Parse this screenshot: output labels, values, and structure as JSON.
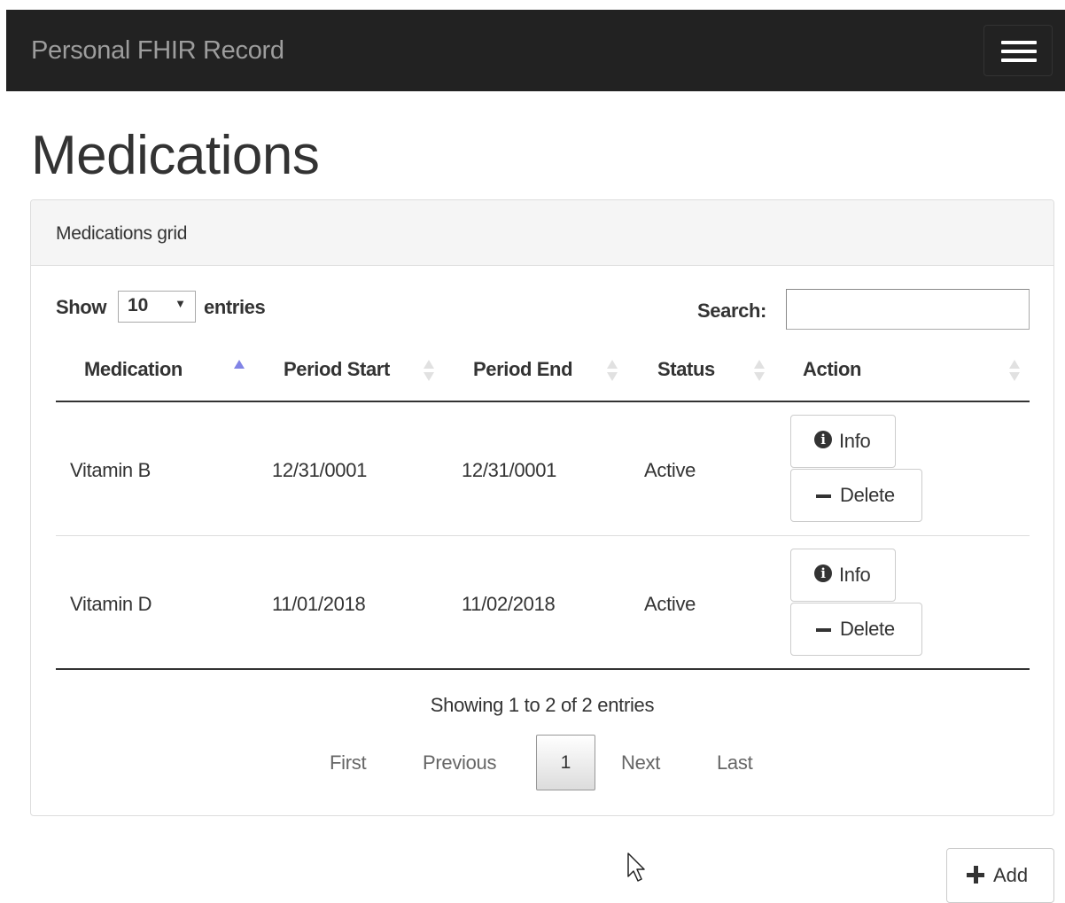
{
  "navbar": {
    "brand": "Personal FHIR Record",
    "menu_icon": "hamburger-menu-icon"
  },
  "page": {
    "title": "Medications"
  },
  "panel": {
    "heading": "Medications grid"
  },
  "length_control": {
    "show_label": "Show",
    "selected": "10",
    "entries_label": "entries"
  },
  "search": {
    "label": "Search:",
    "value": ""
  },
  "table": {
    "columns": [
      "Medication",
      "Period Start",
      "Period End",
      "Status",
      "Action"
    ],
    "sorted_column": "Medication",
    "sort_direction": "ascending",
    "rows": [
      {
        "medication": "Vitamin B",
        "period_start": "12/31/0001",
        "period_end": "12/31/0001",
        "status": "Active",
        "info_label": "Info",
        "delete_label": "Delete"
      },
      {
        "medication": "Vitamin D",
        "period_start": "11/01/2018",
        "period_end": "11/02/2018",
        "status": "Active",
        "info_label": "Info",
        "delete_label": "Delete"
      }
    ]
  },
  "summary": "Showing 1 to 2 of 2 entries",
  "pagination": {
    "first": "First",
    "previous": "Previous",
    "current": "1",
    "next": "Next",
    "last": "Last"
  },
  "add_button": {
    "label": "Add",
    "icon": "plus-icon"
  },
  "colors": {
    "navbar_bg": "#222222",
    "brand_text": "#9d9d9d",
    "sort_active": "#8184e6",
    "sort_inactive": "#e1e1e1"
  }
}
